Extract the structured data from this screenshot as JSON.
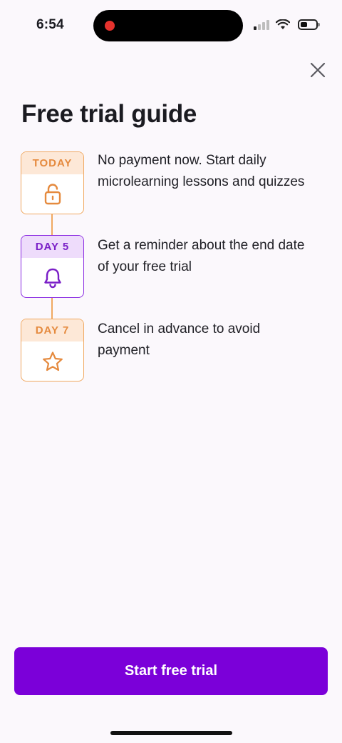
{
  "status_bar": {
    "time": "6:54"
  },
  "header": {
    "title": "Free trial guide"
  },
  "steps": [
    {
      "label": "TODAY",
      "icon": "unlock-icon",
      "text": "No payment now. Start daily microlearning lessons and quizzes"
    },
    {
      "label": "DAY 5",
      "icon": "bell-icon",
      "text": "Get a reminder about the end date of your free trial"
    },
    {
      "label": "DAY 7",
      "icon": "star-icon",
      "text": "Cancel in advance to avoid payment"
    }
  ],
  "cta": {
    "label": "Start free trial"
  },
  "colors": {
    "accent": "#7b00d9",
    "orange": "#e58a3e",
    "purple": "#7a1fc7",
    "background": "#fbf8fc"
  }
}
